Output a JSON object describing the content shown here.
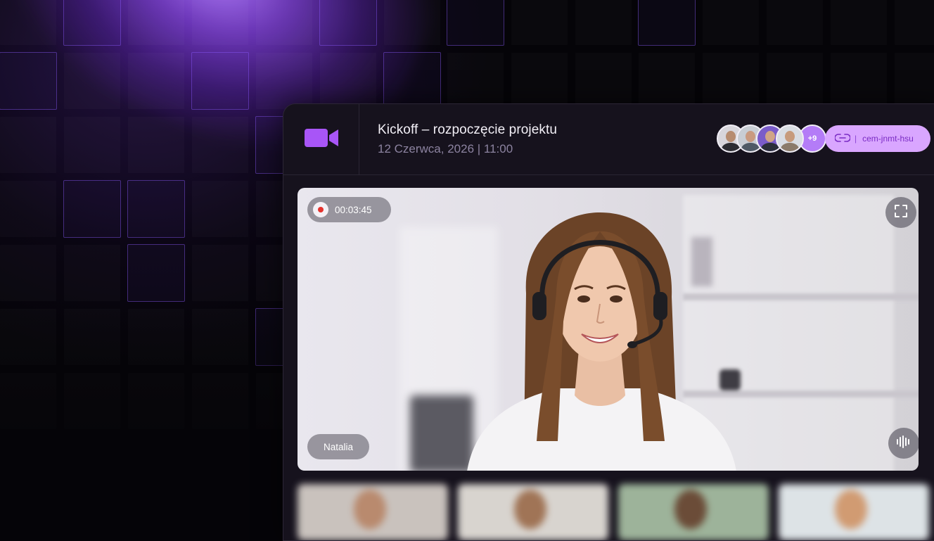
{
  "meeting": {
    "title": "Kickoff – rozpoczęcie projektu",
    "datetime": "12 Czerwca, 2026 | 11:00"
  },
  "participants": {
    "more_count": "+9",
    "avatar_colors": [
      "#3a3a40",
      "#5b6470",
      "#7a5cc9",
      "#c9b59a"
    ]
  },
  "meeting_link": {
    "code": "cem-jnmt-hsu",
    "separator": "|"
  },
  "video": {
    "recording_time": "00:03:45",
    "speaker_name": "Natalia"
  },
  "icons": {
    "logo": "video-camera-icon",
    "link": "link-icon",
    "fullscreen": "fullscreen-icon",
    "audio": "audio-waveform-icon",
    "recording": "record-dot-icon"
  },
  "colors": {
    "accent": "#a855f7",
    "link_pill_bg": "#d9a6ff",
    "link_pill_text": "#7a2bc4",
    "recording_dot": "#e5322d",
    "window_bg": "#16121d"
  }
}
